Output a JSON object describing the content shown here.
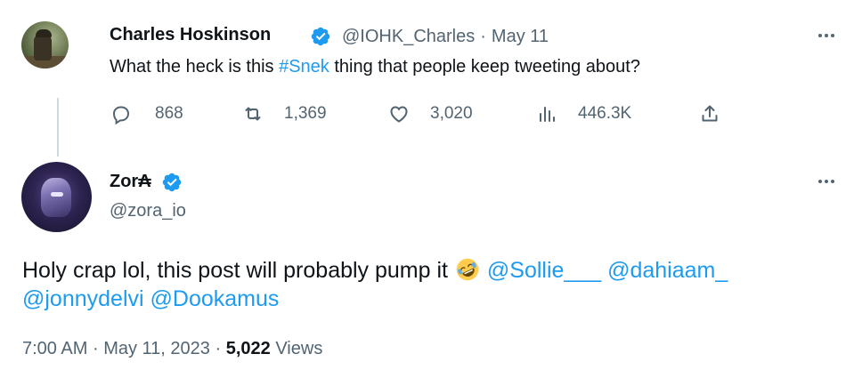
{
  "parent_tweet": {
    "author_name": "Charles Hoskinson",
    "handle": "@IOHK_Charles",
    "separator": "·",
    "date": "May 11",
    "text_before": "What the heck is this ",
    "hashtag": "#Snek",
    "text_after": " thing that people keep tweeting about?",
    "actions": {
      "replies": "868",
      "retweets": "1,369",
      "likes": "3,020",
      "views": "446.3K"
    }
  },
  "reply_tweet": {
    "author_name": "Zor₳",
    "handle": "@zora_io",
    "text": "Holy crap lol, this post will probably pump it",
    "emoji": "rolling-on-floor-laughing",
    "mentions": [
      "@Sollie___",
      "@dahiaam_",
      "@jonnydelvi",
      "@Dookamus"
    ],
    "time": "7:00 AM",
    "date": "May 11, 2023",
    "separator": "·",
    "views_count": "5,022",
    "views_label": "Views"
  },
  "colors": {
    "link": "#1d9bf0",
    "secondary_text": "#536471",
    "primary_text": "#0f1419",
    "verified": "#1d9bf0"
  },
  "icons": [
    "verified-badge-icon",
    "more-icon",
    "reply-icon",
    "retweet-icon",
    "like-icon",
    "views-icon",
    "share-icon",
    "emoji-rofl-icon"
  ]
}
